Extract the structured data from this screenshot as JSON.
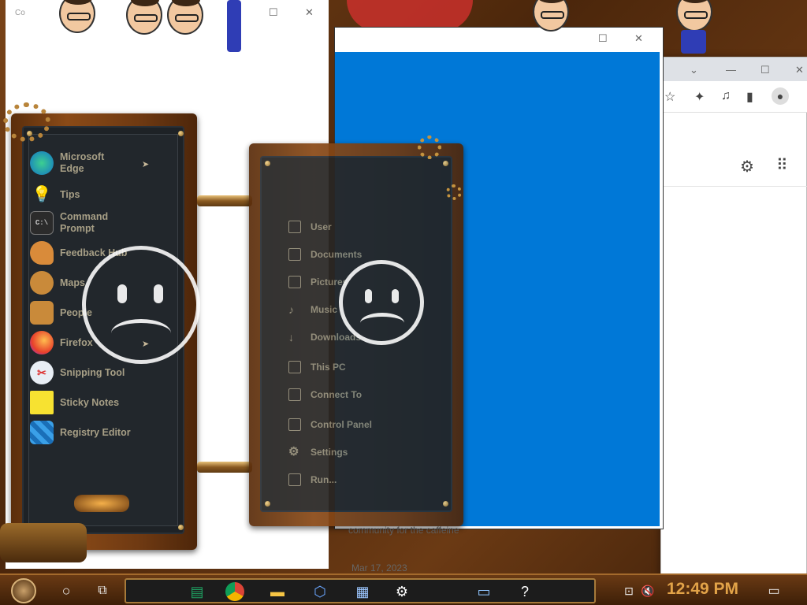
{
  "left_window": {
    "title": "Co"
  },
  "start_menu": {
    "items": [
      {
        "label": "Microsoft Edge",
        "icon": "edge-icon",
        "has_arrow": true
      },
      {
        "label": "Tips",
        "icon": "lightbulb-icon",
        "has_arrow": false
      },
      {
        "label": "Command Prompt",
        "icon": "command-prompt-icon",
        "has_arrow": false
      },
      {
        "label": "Feedback Hub",
        "icon": "feedback-icon",
        "has_arrow": false
      },
      {
        "label": "Maps",
        "icon": "maps-icon",
        "has_arrow": false
      },
      {
        "label": "People",
        "icon": "people-icon",
        "has_arrow": false
      },
      {
        "label": "Firefox",
        "icon": "firefox-icon",
        "has_arrow": true
      },
      {
        "label": "Snipping Tool",
        "icon": "snipping-tool-icon",
        "has_arrow": false
      },
      {
        "label": "Sticky Notes",
        "icon": "sticky-notes-icon",
        "has_arrow": false
      },
      {
        "label": "Registry Editor",
        "icon": "registry-editor-icon",
        "has_arrow": false
      }
    ]
  },
  "places_menu": {
    "items": [
      {
        "label": "User",
        "icon": "user-icon"
      },
      {
        "label": "Documents",
        "icon": "documents-icon"
      },
      {
        "label": "Pictures",
        "icon": "pictures-icon"
      },
      {
        "label": "Music",
        "icon": "music-icon"
      },
      {
        "label": "Downloads",
        "icon": "downloads-icon"
      },
      {
        "label": "This PC",
        "icon": "this-pc-icon"
      },
      {
        "label": "Connect To",
        "icon": "connect-to-icon"
      },
      {
        "label": "Control Panel",
        "icon": "control-panel-icon"
      },
      {
        "label": "Settings",
        "icon": "settings-icon"
      },
      {
        "label": "Run...",
        "icon": "run-icon"
      }
    ]
  },
  "background_page": {
    "caption": "community for the caffeine",
    "date": "Mar 17, 2023"
  },
  "taskbar": {
    "clock": "12:49 PM",
    "apps": [
      "sheets-icon",
      "chrome-icon",
      "file-explorer-icon",
      "virtualbox-icon",
      "calculator-icon",
      "settings-gear-icon",
      "remote-desktop-icon",
      "help-icon"
    ]
  },
  "colors": {
    "blue_window": "#0078d7",
    "clock": "#e2a348",
    "menu_text": "#a79f86"
  }
}
